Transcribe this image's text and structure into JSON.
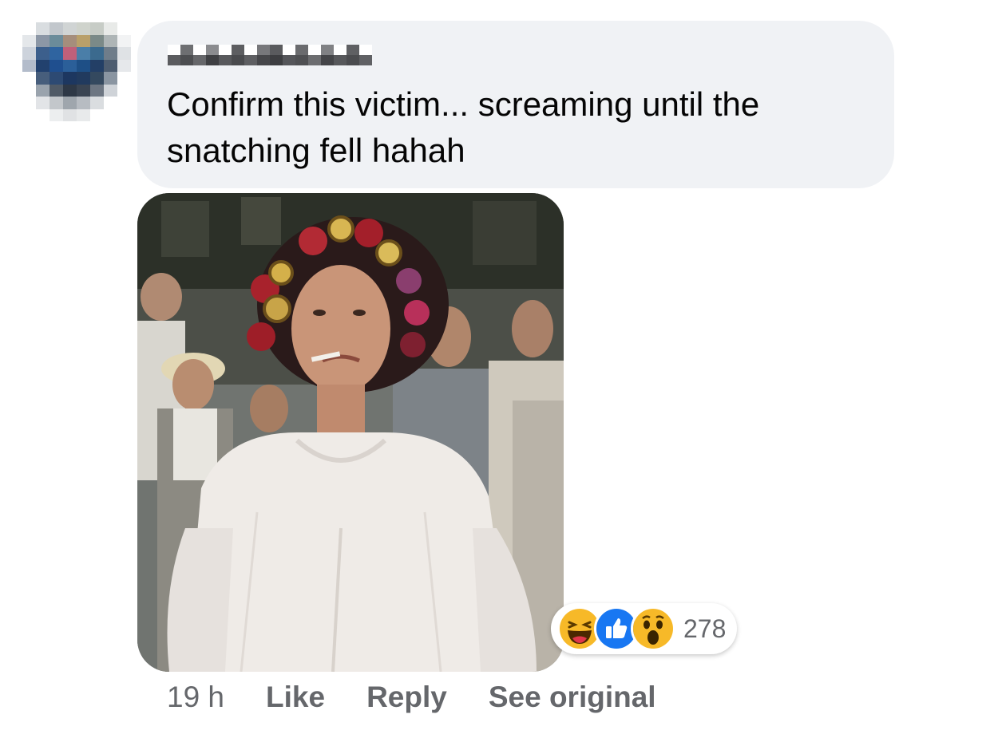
{
  "comment": {
    "text": "Confirm this victim... screaming until the snatching fell hahah"
  },
  "reactions": {
    "icons": [
      "haha-icon",
      "like-icon",
      "wow-icon"
    ],
    "count": "278"
  },
  "actions": {
    "timestamp": "19 h",
    "like_label": "Like",
    "reply_label": "Reply",
    "see_original_label": "See original"
  },
  "colors": {
    "bubble_bg": "#f0f2f5",
    "text": "#050505",
    "secondary_text": "#65676b",
    "like_blue": "#1877f2",
    "emoji_yellow": "#f7b928"
  }
}
